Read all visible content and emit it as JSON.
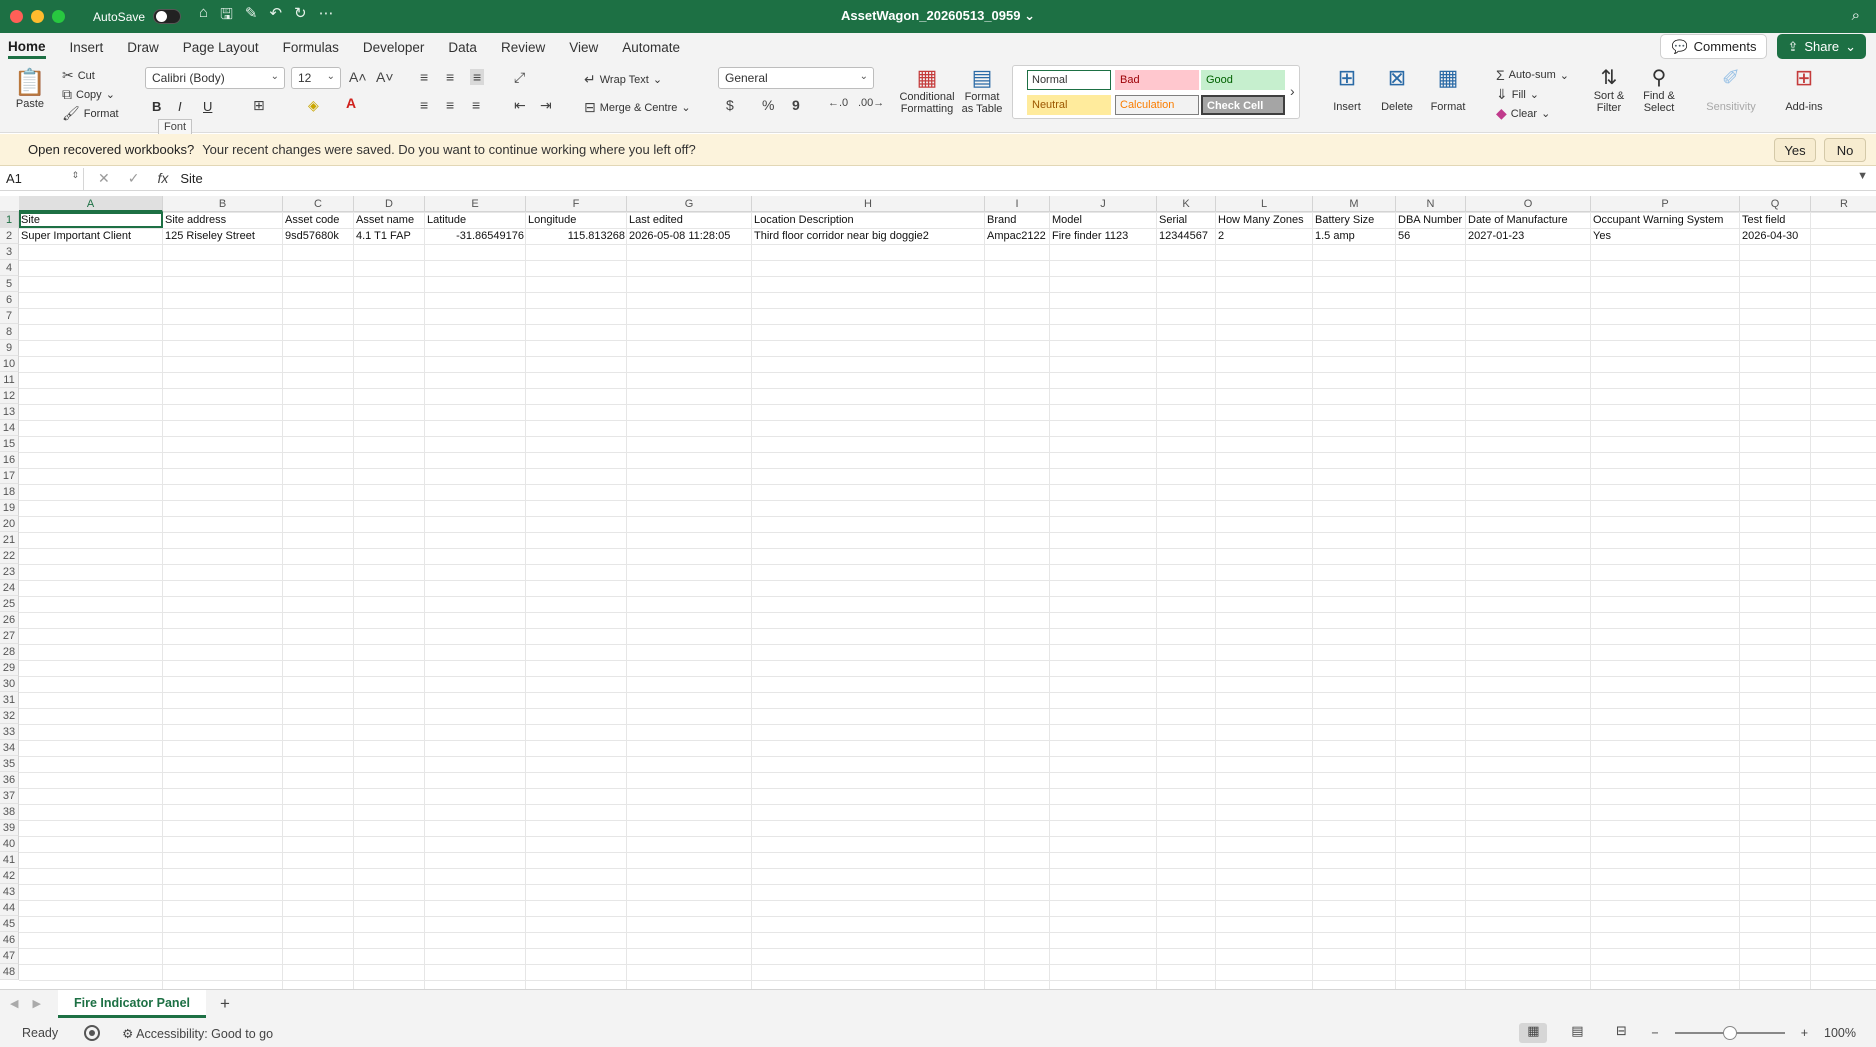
{
  "titlebar": {
    "autosave_label": "AutoSave",
    "document_title": "AssetWagon_20260513_0959"
  },
  "tabs": [
    "Home",
    "Insert",
    "Draw",
    "Page Layout",
    "Formulas",
    "Developer",
    "Data",
    "Review",
    "View",
    "Automate"
  ],
  "tab_actions": {
    "comments": "Comments",
    "share": "Share"
  },
  "ribbon": {
    "clipboard": {
      "paste": "Paste",
      "cut": "Cut",
      "copy": "Copy",
      "format": "Format"
    },
    "font": {
      "name": "Calibri (Body)",
      "size": "12",
      "bold": "B",
      "italic": "I",
      "underline": "U",
      "tooltip": "Font"
    },
    "alignment": {
      "wrap_text": "Wrap Text",
      "merge_centre": "Merge & Centre"
    },
    "number": {
      "format": "General",
      "currency": "$",
      "percent": "%",
      "comma": "9"
    },
    "styles": {
      "conditional_formatting": [
        "Conditional",
        "Formatting"
      ],
      "format_as_table": [
        "Format",
        "as Table"
      ],
      "normal": "Normal",
      "bad": "Bad",
      "good": "Good",
      "neutral": "Neutral",
      "calculation": "Calculation",
      "check_cell": "Check Cell"
    },
    "cells": {
      "insert": "Insert",
      "delete": "Delete",
      "format": "Format"
    },
    "editing": {
      "autosum": "Auto-sum",
      "fill": "Fill",
      "clear": "Clear",
      "sort_filter": [
        "Sort &",
        "Filter"
      ],
      "find_select": [
        "Find &",
        "Select"
      ]
    },
    "sensitivity": "Sensitivity",
    "addins": "Add-ins"
  },
  "message_bar": {
    "title": "Open recovered workbooks?",
    "body": "Your recent changes were saved. Do you want to continue working where you left off?",
    "yes": "Yes",
    "no": "No"
  },
  "formula_bar": {
    "name_box": "A1",
    "fx": "fx",
    "value": "Site"
  },
  "grid": {
    "columns": [
      "A",
      "B",
      "C",
      "D",
      "E",
      "F",
      "G",
      "H",
      "I",
      "J",
      "K",
      "L",
      "M",
      "N",
      "O",
      "P",
      "Q",
      "R"
    ],
    "row_count": 48,
    "header_row": [
      "Site",
      "Site address",
      "Asset code",
      "Asset name",
      "Latitude",
      "Longitude",
      "Last edited",
      "Location Description",
      "Brand",
      "Model",
      "Serial",
      "How Many Zones",
      "Battery Size",
      "DBA Number",
      "Date of Manufacture",
      "Occupant Warning System",
      "Test field",
      ""
    ],
    "data_rows": [
      [
        "Super Important Client",
        "125 Riseley Street",
        "9sd57680k",
        "4.1 T1 FAP",
        "-31.86549176",
        "115.813268",
        "2026-05-08 11:28:05",
        "Third floor corridor near big doggie2",
        "Ampac2122",
        "Fire finder 1123",
        "12344567",
        "2",
        "1.5 amp",
        "56",
        "2027-01-23",
        "Yes",
        "2026-04-30",
        ""
      ]
    ]
  },
  "sheet_tabs": {
    "active": "Fire Indicator Panel",
    "add": "+"
  },
  "status": {
    "ready": "Ready",
    "accessibility": "Accessibility: Good to go",
    "zoom": "100%"
  }
}
